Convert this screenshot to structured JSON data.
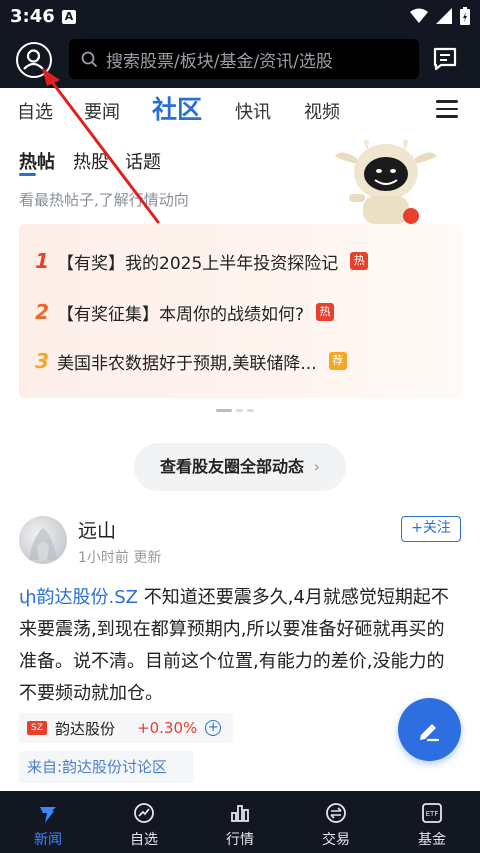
{
  "status_bar": {
    "time": "3:46",
    "a_label": "A"
  },
  "header": {
    "search_placeholder": "搜索股票/板块/基金/资讯/选股"
  },
  "nav_tabs": [
    {
      "label": "自选"
    },
    {
      "label": "要闻"
    },
    {
      "label": "社区",
      "active": true
    },
    {
      "label": "快讯"
    },
    {
      "label": "视频"
    }
  ],
  "sub_tabs": [
    {
      "label": "热帖",
      "active": true
    },
    {
      "label": "热股"
    },
    {
      "label": "话题"
    }
  ],
  "sub_desc": "看最热帖子,了解行情动向",
  "hot_list": [
    {
      "rank": "1",
      "text": "【有奖】我的2025上半年投资探险记",
      "tag": "热",
      "rank_color": "#e8402d",
      "tag_color": "#e8402d"
    },
    {
      "rank": "2",
      "text": "【有奖征集】本周你的战绩如何?",
      "tag": "热",
      "rank_color": "#f0662a",
      "tag_color": "#e8402d"
    },
    {
      "rank": "3",
      "text": "美国非农数据好于预期,美联储降...",
      "tag": "荐",
      "rank_color": "#f5a623",
      "tag_color": "#f5a623"
    }
  ],
  "view_all": "查看股友圈全部动态",
  "post": {
    "author": "远山",
    "meta": "1小时前 更新",
    "follow_label": "+关注",
    "stock_link": "韵达股份.SZ",
    "body": " 不知道还要震多久,4月就感觉短期起不来要震荡,到现在都算预期内,所以要准备好砸就再买的准备。说不清。目前这个位置,有能力的差价,没能力的不要频动就加仓。",
    "stock_chip": {
      "badge": "SZ",
      "name": "韵达股份",
      "change": "+0.30%"
    },
    "source": "来自:韵达股份讨论区"
  },
  "bottom_nav": [
    {
      "label": "新闻",
      "icon": "news-icon",
      "active": true
    },
    {
      "label": "自选",
      "icon": "watchlist-icon"
    },
    {
      "label": "行情",
      "icon": "market-icon"
    },
    {
      "label": "交易",
      "icon": "trade-icon"
    },
    {
      "label": "基金",
      "icon": "fund-icon"
    }
  ],
  "colors": {
    "accent": "#2a6fd6",
    "dark_bar": "#131722",
    "red": "#e8402d"
  }
}
